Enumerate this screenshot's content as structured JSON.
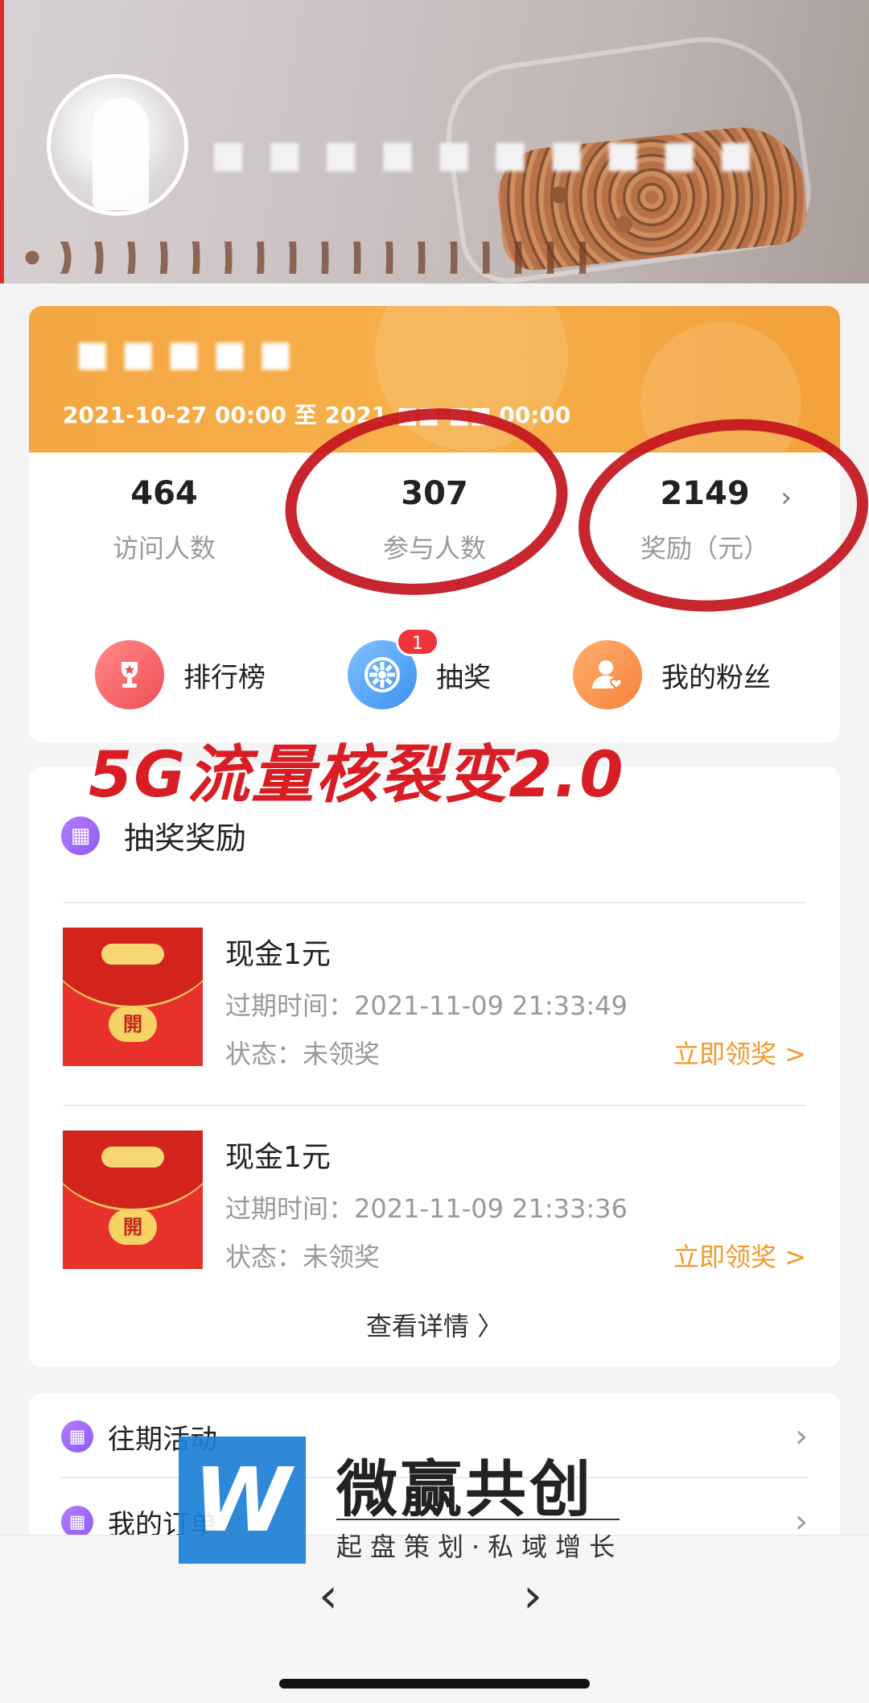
{
  "profile": {
    "username_blurred": "■ ■  ■ ■ ■ ■ ■ ■ ■ ■"
  },
  "campaign": {
    "name_blurred": "■ ■ ■ ■ ■",
    "date_range": "2021-10-27 00:00 至 2021-■■-■■ 00:00",
    "stats": [
      {
        "value": "464",
        "label": "访问人数"
      },
      {
        "value": "307",
        "label": "参与人数"
      },
      {
        "value": "2149",
        "label": "奖励（元）"
      }
    ],
    "actions": [
      {
        "label": "排行榜",
        "icon": "trophy-icon"
      },
      {
        "label": "抽奖",
        "icon": "wheel-icon",
        "badge": "1"
      },
      {
        "label": "我的粉丝",
        "icon": "fans-icon"
      }
    ]
  },
  "promo_text": "5G流量核裂变2.0",
  "rewards": {
    "title": "抽奖奖励",
    "items": [
      {
        "title": "现金1元",
        "expire_label": "过期时间：",
        "expire_time": "2021-11-09 21:33:49",
        "status_label": "状态：",
        "status": "未领奖",
        "claim": "立即领奖 >",
        "seal": "開"
      },
      {
        "title": "现金1元",
        "expire_label": "过期时间：",
        "expire_time": "2021-11-09 21:33:36",
        "status_label": "状态：",
        "status": "未领奖",
        "claim": "立即领奖 >",
        "seal": "開"
      }
    ],
    "view_details": "查看详情 〉"
  },
  "menu": {
    "items": [
      {
        "label": "往期活动"
      },
      {
        "label": "我的订单"
      }
    ]
  },
  "watermark": {
    "logo_letter": "W",
    "title": "微赢共创",
    "subtitle": "起盘策划·私域增长"
  },
  "browser": {
    "back": "‹",
    "forward": "›"
  },
  "colors": {
    "accent_orange": "#f4a742",
    "badge_red": "#f0343c",
    "claim_orange": "#f39a2b",
    "ink_red": "#c3141d"
  }
}
